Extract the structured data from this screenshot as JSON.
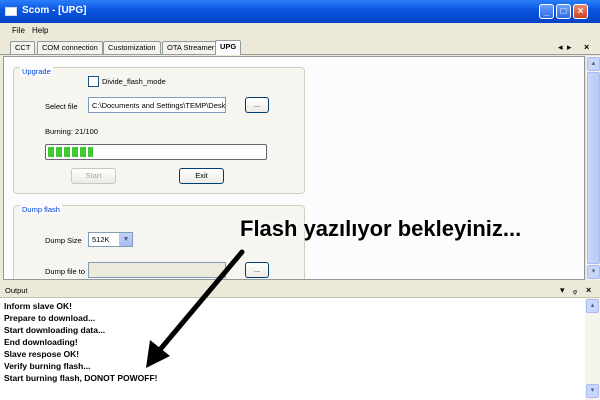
{
  "window": {
    "title": "Scom - [UPG]",
    "minimize": "_",
    "maximize": "□",
    "close": "×"
  },
  "menu": {
    "file": "File",
    "help": "Help"
  },
  "tabs": [
    {
      "label": "CCT"
    },
    {
      "label": "COM connection"
    },
    {
      "label": "Customization"
    },
    {
      "label": "OTA Streamer"
    },
    {
      "label": "UPG",
      "active": true
    }
  ],
  "tab_controls": {
    "scroll_left": "◂",
    "scroll_right": "▸",
    "close": "×"
  },
  "upgrade": {
    "title": "Upgrade",
    "divide_flash_label": "Divide_flash_mode",
    "divide_flash_checked": false,
    "select_file_label": "Select file",
    "file_path": "C:\\Documents and Settings\\TEMP\\Desktop\\s",
    "browse_label": "...",
    "burning_label": "Burning: 21/100",
    "progress_percent": 21,
    "start_label": "Start",
    "exit_label": "Exit"
  },
  "dump": {
    "title": "Dump flash",
    "size_label": "Dump Size",
    "size_value": "512K",
    "file_label": "Dump file to",
    "file_value": "",
    "browse_label": "..."
  },
  "output": {
    "title": "Output",
    "controls": {
      "dropdown": "▾",
      "pin": "ᵩ",
      "close": "×"
    },
    "lines": [
      "Inform slave OK!",
      "Prepare to download...",
      "Start downloading data...",
      "End downloading!",
      "Slave respose OK!",
      "Verify burning flash...",
      "Start burning flash, DONOT POWOFF!"
    ]
  },
  "annotation": {
    "text": "Flash yazılıyor bekleyiniz..."
  },
  "scroll": {
    "up": "▴",
    "down": "▾"
  }
}
